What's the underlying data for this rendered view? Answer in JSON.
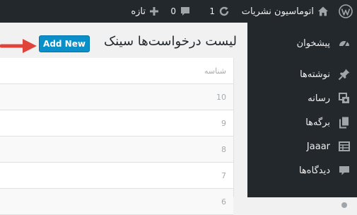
{
  "adminbar": {
    "site_name": "اتوماسیون نشریات",
    "updates_count": "1",
    "comments_count": "0",
    "new_label": "تازه"
  },
  "page": {
    "title": "لیست درخواست‌ها سینک",
    "add_new_label": "Add New"
  },
  "table": {
    "header": "شناسه",
    "rows": [
      "10",
      "9",
      "8",
      "7",
      "6"
    ]
  },
  "sidebar": {
    "items": [
      {
        "label": "پیشخوان",
        "icon": "dashboard-icon"
      },
      {
        "label": "نوشته‌ها",
        "icon": "pin-icon"
      },
      {
        "label": "رسانه",
        "icon": "media-icon"
      },
      {
        "label": "برگه‌ها",
        "icon": "pages-icon"
      },
      {
        "label": "Jaaar",
        "icon": "table-icon"
      },
      {
        "label": "دیدگاه‌ها",
        "icon": "comment-icon"
      }
    ]
  },
  "colors": {
    "adminbar_bg": "#23282d",
    "button_bg": "#0a8fc9",
    "arrow": "#e0433a"
  }
}
